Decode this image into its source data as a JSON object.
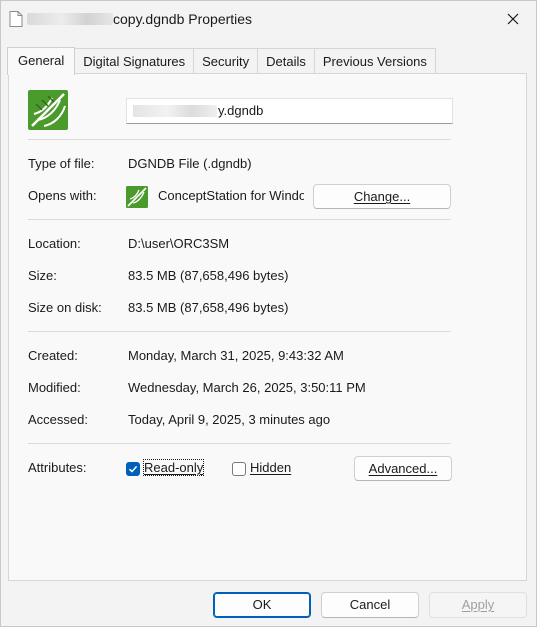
{
  "window": {
    "title_suffix": "copy.dgndb Properties",
    "close_glyph": "✕",
    "close_icon": "close-icon"
  },
  "tabs": [
    {
      "label": "General",
      "active": true
    },
    {
      "label": "Digital Signatures",
      "active": false
    },
    {
      "label": "Security",
      "active": false
    },
    {
      "label": "Details",
      "active": false
    },
    {
      "label": "Previous Versions",
      "active": false
    }
  ],
  "general": {
    "file_name_visible": "y.dgndb",
    "file_icon": "conceptstation-file-icon",
    "type_label": "Type of file:",
    "type_value": "DGNDB File (.dgndb)",
    "opens_label": "Opens with:",
    "opens_value": "ConceptStation for Windows",
    "change_button": "Change...",
    "location_label": "Location:",
    "location_value": "D:\\user\\ORC3SM",
    "size_label": "Size:",
    "size_value": "83.5 MB (87,658,496 bytes)",
    "size_on_disk_label": "Size on disk:",
    "size_on_disk_value": "83.5 MB (87,658,496 bytes)",
    "created_label": "Created:",
    "created_value": "Monday, March 31, 2025, 9:43:32 AM",
    "modified_label": "Modified:",
    "modified_value": "Wednesday, March 26, 2025, 3:50:11 PM",
    "accessed_label": "Accessed:",
    "accessed_value": "Today, April 9, 2025, 3 minutes ago",
    "attributes_label": "Attributes:",
    "readonly_label": "Read-only",
    "readonly_checked": true,
    "hidden_label": "Hidden",
    "hidden_checked": false,
    "advanced_button": "Advanced..."
  },
  "footer": {
    "ok_label": "OK",
    "cancel_label": "Cancel",
    "apply_label": "Apply",
    "apply_enabled": false
  },
  "colors": {
    "accent": "#005fb8",
    "icon_green": "#4a9a2c",
    "window_bg": "#f3f3f3",
    "panel_bg": "#f9f9f9"
  }
}
